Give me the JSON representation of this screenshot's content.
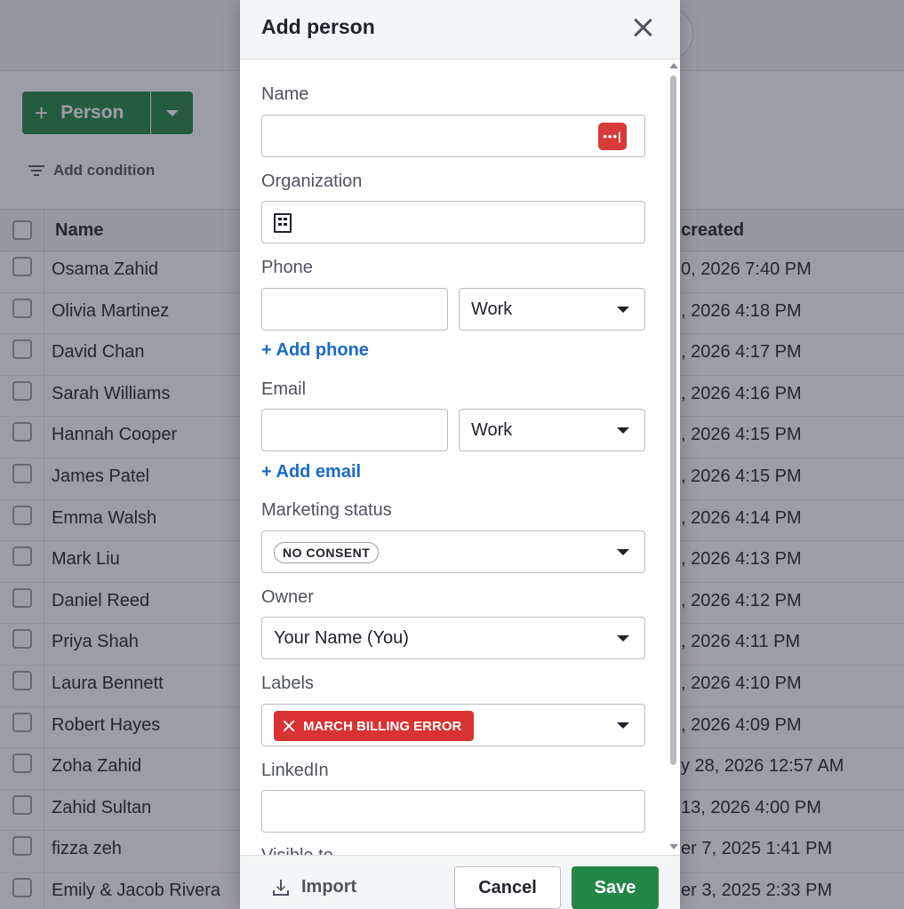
{
  "background": {
    "toolbar": {
      "add_person_label": "Person",
      "add_condition_label": "Add condition"
    },
    "table": {
      "columns": [
        "Name",
        "created"
      ],
      "rows": [
        {
          "name": "Osama Zahid",
          "created": "0, 2026 7:40 PM"
        },
        {
          "name": "Olivia Martinez",
          "created": ", 2026 4:18 PM"
        },
        {
          "name": "David Chan",
          "created": ", 2026 4:17 PM"
        },
        {
          "name": "Sarah Williams",
          "created": ", 2026 4:16 PM"
        },
        {
          "name": "Hannah Cooper",
          "created": ", 2026 4:15 PM"
        },
        {
          "name": "James Patel",
          "created": ", 2026 4:15 PM"
        },
        {
          "name": "Emma Walsh",
          "created": ", 2026 4:14 PM"
        },
        {
          "name": "Mark Liu",
          "created": ", 2026 4:13 PM"
        },
        {
          "name": "Daniel Reed",
          "created": ", 2026 4:12 PM"
        },
        {
          "name": "Priya Shah",
          "created": ", 2026 4:11 PM"
        },
        {
          "name": "Laura Bennett",
          "created": ", 2026 4:10 PM"
        },
        {
          "name": "Robert Hayes",
          "created": ", 2026 4:09 PM"
        },
        {
          "name": "Zoha Zahid",
          "created": "y 28, 2026 12:57 AM"
        },
        {
          "name": "Zahid Sultan",
          "created": "13, 2026 4:00 PM"
        },
        {
          "name": "fizza zeh",
          "created": "er 7, 2025 1:41 PM"
        },
        {
          "name": "Emily & Jacob Rivera",
          "created": "er 3, 2025 2:33 PM"
        }
      ]
    }
  },
  "modal": {
    "title": "Add person",
    "fields": {
      "name_label": "Name",
      "name_value": "",
      "organization_label": "Organization",
      "organization_value": "",
      "phone_label": "Phone",
      "phone_value": "",
      "phone_type": "Work",
      "add_phone": "+ Add phone",
      "email_label": "Email",
      "email_value": "",
      "email_type": "Work",
      "add_email": "+ Add email",
      "marketing_label": "Marketing status",
      "marketing_value": "NO CONSENT",
      "owner_label": "Owner",
      "owner_value": "Your Name (You)",
      "labels_label": "Labels",
      "labels_value": "MARCH BILLING ERROR",
      "linkedin_label": "LinkedIn",
      "linkedin_value": "",
      "visible_label": "Visible to"
    },
    "footer": {
      "import_label": "Import",
      "cancel_label": "Cancel",
      "save_label": "Save"
    },
    "colors": {
      "primary": "#25864a",
      "link": "#1a6ac7",
      "label_tag": "#d93232",
      "password_manager": "#d83a3a"
    },
    "icons": {
      "close": "close-icon",
      "password_manager": "password-manager-icon",
      "organization": "building-icon",
      "import": "import-icon"
    }
  }
}
